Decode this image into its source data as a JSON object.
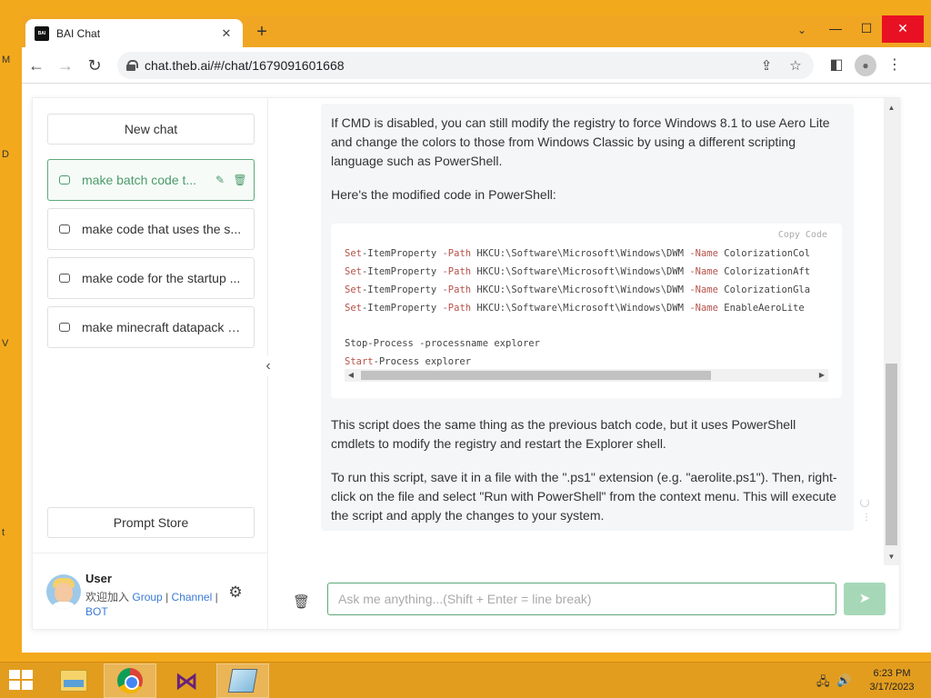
{
  "browser": {
    "tab_title": "BAI Chat",
    "tab_favicon_text": "BAI",
    "url": "chat.theb.ai/#/chat/1679091601668",
    "window_controls": {
      "minimize": "—",
      "maximize": "☐",
      "close": "✕"
    }
  },
  "sidebar": {
    "new_chat_label": "New chat",
    "chats": [
      {
        "label": "make batch code t..."
      },
      {
        "label": "make code that uses the s..."
      },
      {
        "label": "make code for the startup ..."
      },
      {
        "label": "make minecraft datapack c..."
      }
    ],
    "prompt_store_label": "Prompt Store",
    "user": {
      "name": "User",
      "welcome_prefix": "欢迎加入",
      "link_group": "Group",
      "link_channel": "Channel",
      "link_bot": "BOT",
      "separator": "|"
    }
  },
  "message": {
    "intro": "If CMD is disabled, you can still modify the registry to force Windows 8.1 to use Aero Lite and change the colors to those from Windows Classic by using a different scripting language such as PowerShell.",
    "code_intro": "Here's the modified code in PowerShell:",
    "copy_label": "Copy Code",
    "code_lines": [
      {
        "kw": "Set",
        "text": "-ItemProperty ",
        "param": "-Path",
        "rest": " HKCU:\\Software\\Microsoft\\Windows\\DWM ",
        "param2": "-Name",
        "rest2": " ColorizationCol"
      },
      {
        "kw": "Set",
        "text": "-ItemProperty ",
        "param": "-Path",
        "rest": " HKCU:\\Software\\Microsoft\\Windows\\DWM ",
        "param2": "-Name",
        "rest2": " ColorizationAft"
      },
      {
        "kw": "Set",
        "text": "-ItemProperty ",
        "param": "-Path",
        "rest": " HKCU:\\Software\\Microsoft\\Windows\\DWM ",
        "param2": "-Name",
        "rest2": " ColorizationGla"
      },
      {
        "kw": "Set",
        "text": "-ItemProperty ",
        "param": "-Path",
        "rest": " HKCU:\\Software\\Microsoft\\Windows\\DWM ",
        "param2": "-Name",
        "rest2": " EnableAeroLite"
      }
    ],
    "code_stop": "Stop-Process -processname explorer",
    "code_start_kw": "Start",
    "code_start_rest": "-Process explorer",
    "explanation": "This script does the same thing as the previous batch code, but it uses PowerShell cmdlets to modify the registry and restart the Explorer shell.",
    "instructions": "To run this script, save it in a file with the \".ps1\" extension (e.g. \"aerolite.ps1\"). Then, right-click on the file and select \"Run with PowerShell\" from the context menu. This will execute the script and apply the changes to your system."
  },
  "input": {
    "placeholder": "Ask me anything...(Shift + Enter = line break)",
    "value": ""
  },
  "taskbar": {
    "time": "6:23 PM",
    "date": "3/17/2023"
  },
  "desktop_letters": [
    "M",
    "D",
    "V",
    "t"
  ],
  "colors": {
    "desktop": "#f3a91c",
    "accent_green": "#5fa87a",
    "send_button": "#a6d8b8"
  }
}
